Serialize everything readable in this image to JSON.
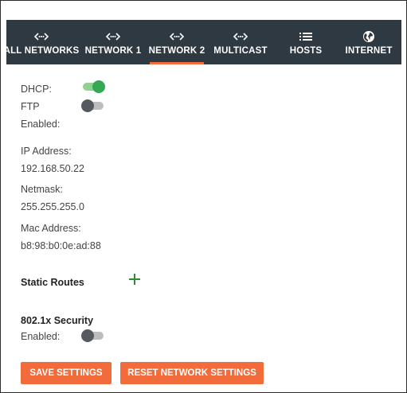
{
  "tabs": [
    {
      "label": "ALL NETWORKS",
      "icon": "network-icon"
    },
    {
      "label": "NETWORK 1",
      "icon": "network-icon"
    },
    {
      "label": "NETWORK 2",
      "icon": "network-icon",
      "active": true
    },
    {
      "label": "MULTICAST",
      "icon": "network-icon"
    },
    {
      "label": "HOSTS",
      "icon": "list-icon"
    },
    {
      "label": "INTERNET",
      "icon": "globe-icon"
    }
  ],
  "settings": {
    "dhcp_label": "DHCP:",
    "dhcp_enabled": true,
    "ftp_label": "FTP",
    "ftp_enabled_label": "Enabled:",
    "ftp_enabled": false,
    "ip_label": "IP Address:",
    "ip_value": "192.168.50.22",
    "netmask_label": "Netmask:",
    "netmask_value": "255.255.255.0",
    "mac_label": "Mac Address:",
    "mac_value": "b8:98:b0:0e:ad:88"
  },
  "static_routes": {
    "title": "Static Routes"
  },
  "security": {
    "title": "802.1x Security",
    "enabled_label": "Enabled:",
    "enabled": false
  },
  "buttons": {
    "save": "SAVE SETTINGS",
    "reset": "RESET NETWORK SETTINGS"
  },
  "colors": {
    "nav_bg": "#2f3941",
    "accent": "#f26b3a",
    "toggle_on": "#34a853",
    "plus": "#2e8b2e"
  }
}
